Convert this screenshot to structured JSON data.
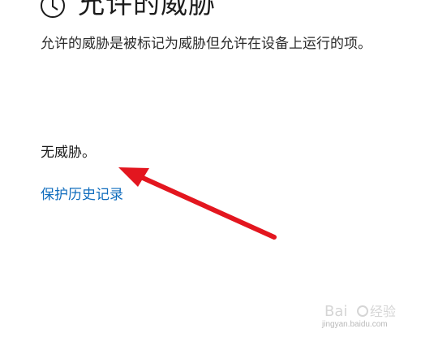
{
  "page": {
    "title": "允许的威胁",
    "description": "允许的威胁是被标记为威胁但允许在设备上运行的项。",
    "status_text": "无威胁。",
    "history_link": "保护历史记录"
  },
  "icons": {
    "header": "history-clock-icon",
    "annotation": "red-arrow-annotation"
  },
  "watermark": {
    "brand": "Baidu 经验",
    "url": "jingyan.baidu.com"
  },
  "colors": {
    "link": "#0f6cbd",
    "arrow": "#e3161f",
    "text": "#1b1b1b"
  }
}
